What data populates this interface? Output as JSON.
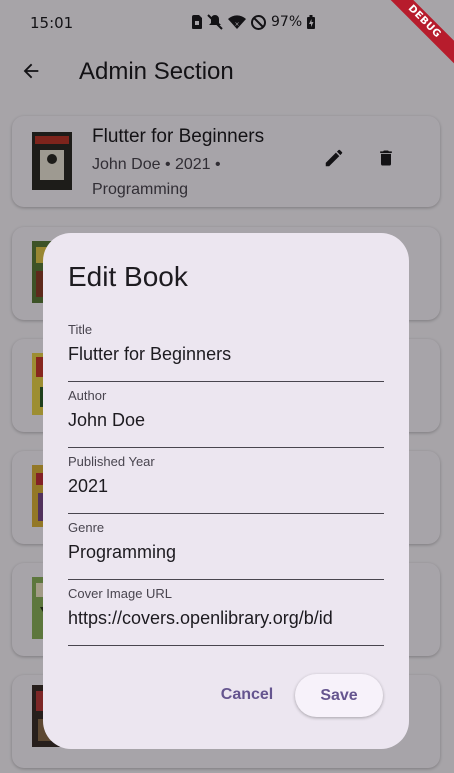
{
  "status_bar": {
    "time": "15:01",
    "battery": "97%",
    "icons": [
      "sim-icon",
      "mute-icon",
      "wifi-icon",
      "dnd-icon",
      "battery-icon"
    ]
  },
  "debug_banner": "DEBUG",
  "app_bar": {
    "title": "Admin Section",
    "back_icon": "arrow-back-icon"
  },
  "books": [
    {
      "title": "Flutter for Beginners",
      "meta": "John Doe • 2021 • Programming",
      "cover_color": "#2b2a26"
    },
    {
      "title": "",
      "meta": "",
      "cover_color": "#5a7b3a"
    },
    {
      "title": "",
      "meta": "",
      "cover_color": "#c83a2e"
    },
    {
      "title": "",
      "meta": "",
      "cover_color": "#d9b13a"
    },
    {
      "title": "",
      "meta": "",
      "cover_color": "#8ab05a"
    },
    {
      "title": "",
      "meta": "",
      "cover_color": "#3a2f2a"
    }
  ],
  "dialog": {
    "title": "Edit Book",
    "fields": [
      {
        "label": "Title",
        "value": "Flutter for Beginners"
      },
      {
        "label": "Author",
        "value": "John Doe"
      },
      {
        "label": "Published Year",
        "value": "2021"
      },
      {
        "label": "Genre",
        "value": "Programming"
      },
      {
        "label": "Cover Image URL",
        "value": "https://covers.openlibrary.org/b/id"
      }
    ],
    "cancel_label": "Cancel",
    "save_label": "Save"
  },
  "colors": {
    "primary": "#65558f",
    "dialog_bg": "#ece6f0",
    "surface": "#f7f2fa"
  }
}
